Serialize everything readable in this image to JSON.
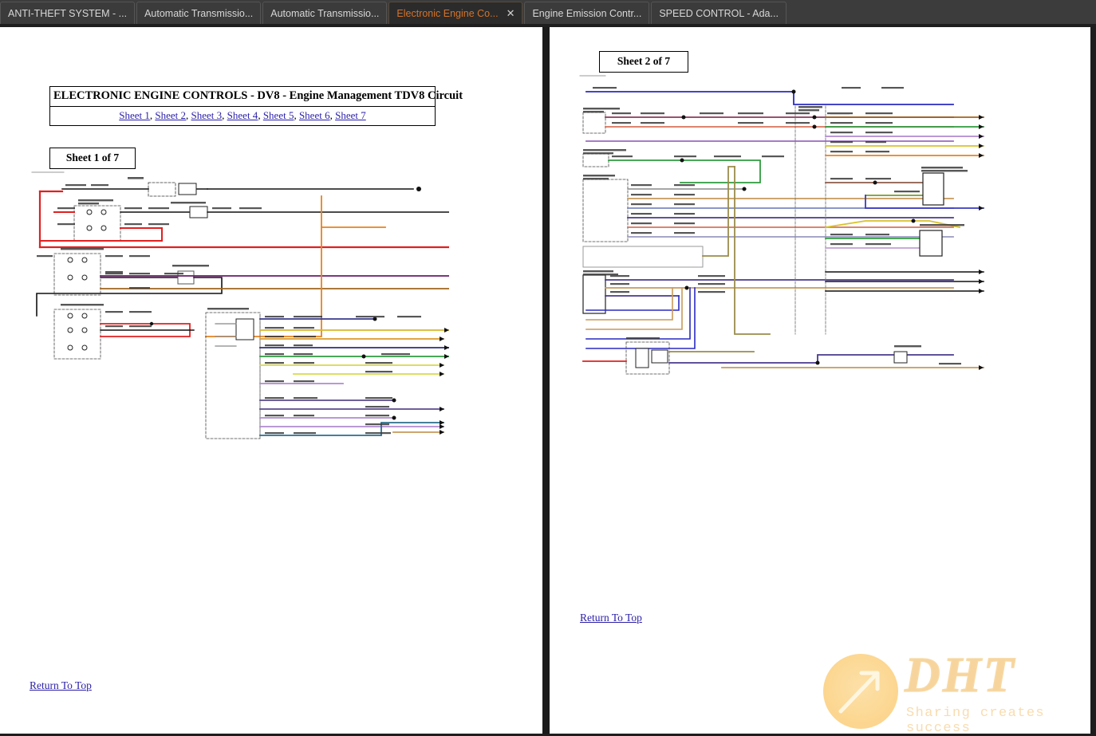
{
  "browser": {
    "tabs": [
      {
        "label": "ANTI-THEFT SYSTEM - ...",
        "active": false,
        "closable": false
      },
      {
        "label": "Automatic Transmissio...",
        "active": false,
        "closable": false
      },
      {
        "label": "Automatic Transmissio...",
        "active": false,
        "closable": false
      },
      {
        "label": "Electronic Engine Co...",
        "active": true,
        "closable": true,
        "close_glyph": "✕"
      },
      {
        "label": "Engine Emission Contr...",
        "active": false,
        "closable": false
      },
      {
        "label": "SPEED CONTROL - Ada...",
        "active": false,
        "closable": false
      }
    ],
    "active_tab_color": "#d4722a",
    "tab_text_color": "#d7d7d7",
    "chrome_color": "#3c3c3c"
  },
  "document": {
    "title": "ELECTRONIC ENGINE CONTROLS - DV8 - Engine Management TDV8 Circuit",
    "sheet_links": [
      {
        "label": "Sheet 1"
      },
      {
        "label": "Sheet 2"
      },
      {
        "label": "Sheet 3"
      },
      {
        "label": "Sheet 4"
      },
      {
        "label": "Sheet 5"
      },
      {
        "label": "Sheet 6"
      },
      {
        "label": "Sheet 7"
      }
    ],
    "link_separator": ", ",
    "link_color": "#2a1fa8",
    "pages": [
      {
        "sheet_badge": "Sheet 1 of 7",
        "return_link": "Return To Top",
        "component_labels": [
          "Battery",
          "Junction box 2: Battery",
          "Dash-side junction",
          "Junction box: Battery",
          "Dash through panel",
          "Junction box: Auxiliary",
          "Starter motor",
          "Junction box: engine"
        ]
      },
      {
        "sheet_badge": "Sheet 2 of 7",
        "return_link": "Return To Top",
        "component_labels": [
          "Switch: Brake pedal",
          "Switch: Automatic transmission",
          "Assembly: ECM-DV8",
          "Switch: Oil pressure",
          "Sensor: Water in fuel",
          "Junction box: Rear",
          "Engine control module (ECM)",
          "Solenoid: Active engine mount",
          "Sensor: Temperature/coolant",
          "Shift/Fuel Tank"
        ]
      }
    ]
  },
  "watermark": {
    "brand": "DHT",
    "tagline": "Sharing creates success",
    "color": "#f8d9a4"
  }
}
